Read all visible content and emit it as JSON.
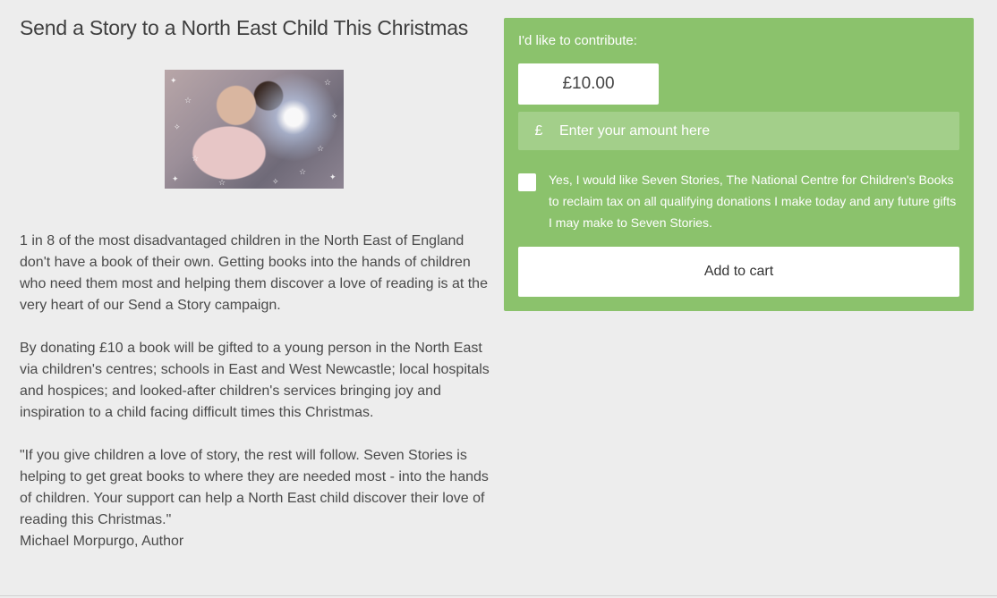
{
  "campaign": {
    "title": "Send a Story to a North East Child This Christmas",
    "image_alt": "Children reading a glowing book",
    "paragraphs": [
      "1 in 8 of the most disadvantaged children in the North East of England don't have a book of their own. Getting books into the hands of children who need them most and helping them discover a love of reading is at the very heart of our Send a Story campaign.",
      "By donating £10 a book will be gifted to a young person in the North East via children's centres; schools in East and West Newcastle; local hospitals and hospices; and looked-after children's services bringing joy and inspiration to a child facing difficult times this Christmas.",
      "\"If you give children a love of story, the rest will follow. Seven Stories is helping to get great books to where they are needed most - into the hands of children. Your support can help a North East child discover their love of reading this Christmas.\""
    ],
    "quote_author": "Michael Morpurgo, Author"
  },
  "donation": {
    "label": "I'd like to contribute:",
    "preset_amount": "£10.00",
    "currency_symbol": "£",
    "amount_placeholder": "Enter your amount here",
    "gift_aid_text": "Yes, I would like Seven Stories, The National Centre for Children's Books to reclaim tax on all qualifying donations I make today and any future gifts I may make to Seven Stories.",
    "gift_aid_checked": false,
    "add_to_cart_label": "Add to cart"
  },
  "colors": {
    "panel": "#8bc26c",
    "field": "#a3cf8a",
    "background": "#ededed"
  }
}
